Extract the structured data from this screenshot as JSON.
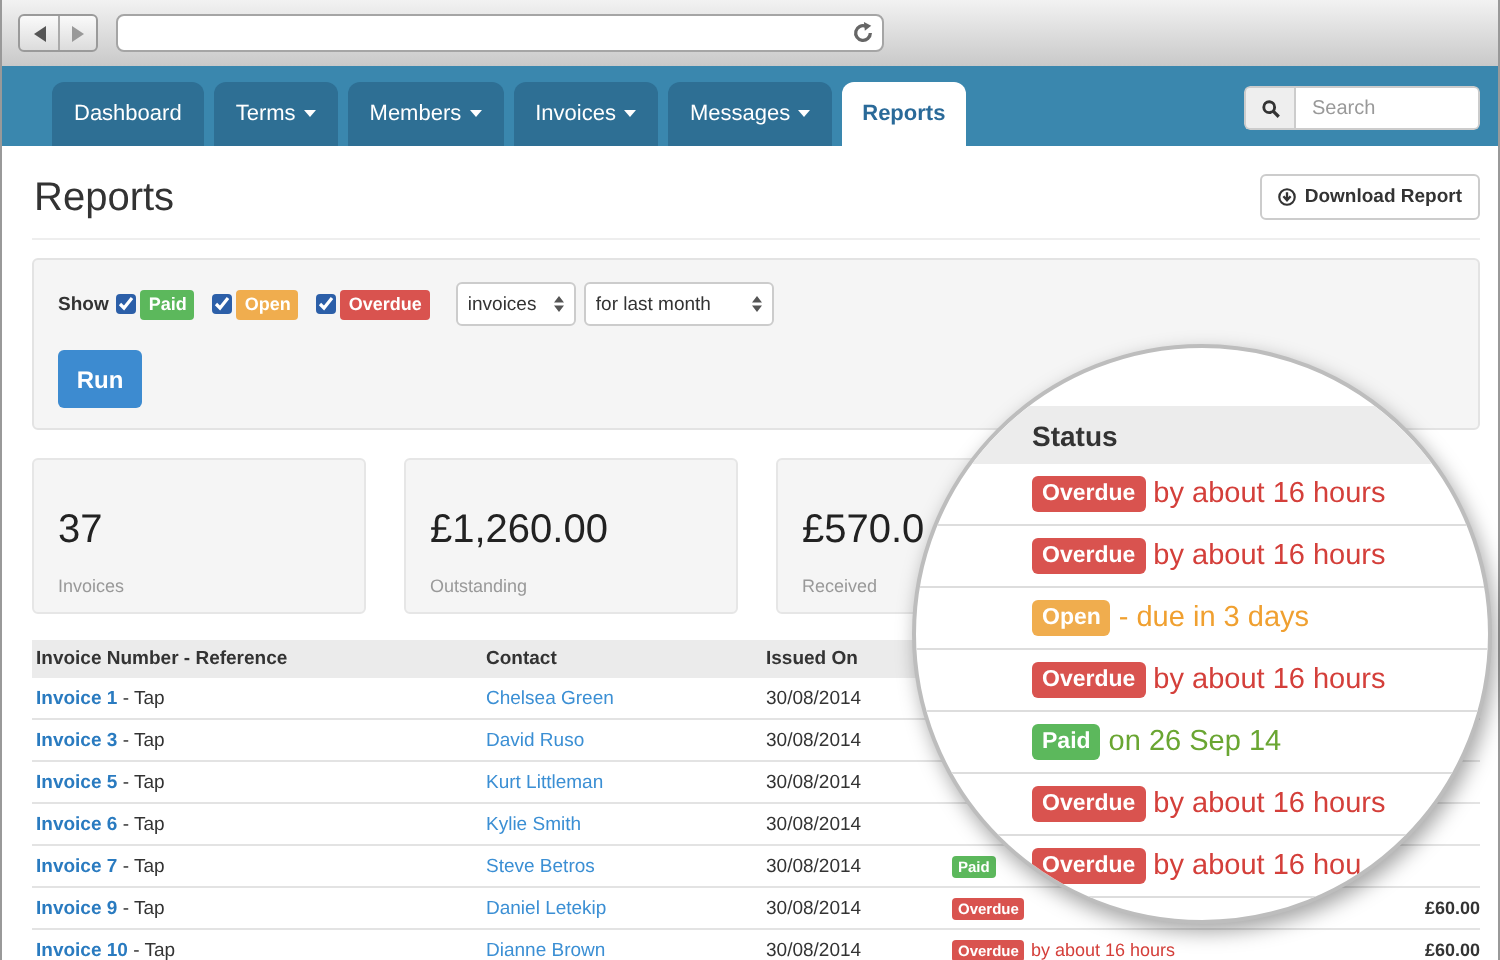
{
  "nav": {
    "tabs": [
      {
        "label": "Dashboard",
        "selected": false,
        "dropdown": false
      },
      {
        "label": "Terms",
        "selected": false,
        "dropdown": true
      },
      {
        "label": "Members",
        "selected": false,
        "dropdown": true
      },
      {
        "label": "Invoices",
        "selected": false,
        "dropdown": true
      },
      {
        "label": "Messages",
        "selected": false,
        "dropdown": true
      },
      {
        "label": "Reports",
        "selected": true,
        "dropdown": false
      }
    ],
    "search": {
      "placeholder": "Search"
    }
  },
  "page": {
    "title": "Reports",
    "download_button": "Download Report"
  },
  "filters": {
    "show_label": "Show",
    "statuses": [
      {
        "label": "Paid",
        "checked": true,
        "color": "#5cb85c"
      },
      {
        "label": "Open",
        "checked": true,
        "color": "#f0ad4e"
      },
      {
        "label": "Overdue",
        "checked": true,
        "color": "#d9534f"
      }
    ],
    "type_select": "invoices",
    "period_select": "for last month",
    "run_button": "Run"
  },
  "summary_cards": [
    {
      "value": "37",
      "label": "Invoices"
    },
    {
      "value": "£1,260.00",
      "label": "Outstanding"
    },
    {
      "value": "£570.0",
      "label": "Received"
    }
  ],
  "table": {
    "columns": [
      "Invoice Number - Reference",
      "Contact",
      "Issued On"
    ],
    "rows": [
      {
        "invoice": "Invoice 1",
        "reference": "- Tap",
        "contact": "Chelsea Green",
        "issued_on": "30/08/2014"
      },
      {
        "invoice": "Invoice 3",
        "reference": "- Tap",
        "contact": "David Ruso",
        "issued_on": "30/08/2014"
      },
      {
        "invoice": "Invoice 5",
        "reference": "- Tap",
        "contact": "Kurt Littleman",
        "issued_on": "30/08/2014"
      },
      {
        "invoice": "Invoice 6",
        "reference": "- Tap",
        "contact": "Kylie Smith",
        "issued_on": "30/08/2014"
      },
      {
        "invoice": "Invoice 7",
        "reference": "- Tap",
        "contact": "Steve Betros",
        "issued_on": "30/08/2014",
        "status": {
          "label": "Paid",
          "color": "#5cb85c"
        }
      },
      {
        "invoice": "Invoice 9",
        "reference": "- Tap",
        "contact": "Daniel Letekip",
        "issued_on": "30/08/2014",
        "status": {
          "label": "Overdue",
          "color": "#d9534f"
        },
        "amount": "£60.00"
      },
      {
        "invoice": "Invoice 10",
        "reference": "- Tap",
        "contact": "Dianne Brown",
        "issued_on": "30/08/2014",
        "status": {
          "label": "Overdue",
          "kind": "overdue",
          "color": "#d9534f"
        },
        "note": "by about 16 hours",
        "amount": "£60.00"
      }
    ]
  },
  "magnifier": {
    "header": "Status",
    "rows": [
      {
        "label": "Overdue",
        "kind": "overdue",
        "color": "#d9534f",
        "note": "by about 16 hours"
      },
      {
        "label": "Overdue",
        "kind": "overdue",
        "color": "#d9534f",
        "note": "by about 16 hours"
      },
      {
        "label": "Open",
        "kind": "open",
        "color": "#f0ad4e",
        "note": "- due in 3 days"
      },
      {
        "label": "Overdue",
        "kind": "overdue",
        "color": "#d9534f",
        "note": "by about 16 hours"
      },
      {
        "label": "Paid",
        "kind": "paid",
        "color": "#5cb85c",
        "note": "on 26 Sep 14"
      },
      {
        "label": "Overdue",
        "kind": "overdue",
        "color": "#d9534f",
        "note": "by about 16 hours"
      },
      {
        "label": "Overdue",
        "kind": "overdue",
        "color": "#d9534f",
        "note": "by about 16 hou"
      }
    ]
  }
}
